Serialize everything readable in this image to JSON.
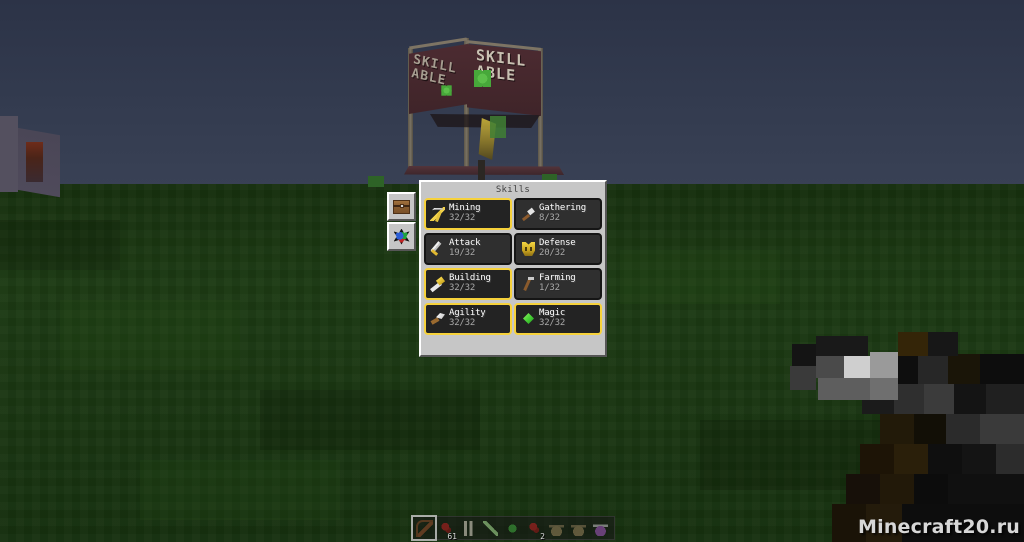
{
  "game": {
    "title": "Minecraft",
    "watermark": "Minecraft20.ru"
  },
  "world": {
    "sign": {
      "line1": "SKILL",
      "line2": "ABLE",
      "left_line1": "SKILL",
      "left_line2": "ABLE"
    }
  },
  "tabs": [
    {
      "id": "tab-inventory",
      "icon": "chest-icon",
      "selected": true
    },
    {
      "id": "tab-skills",
      "icon": "web-icon",
      "selected": false
    }
  ],
  "panel": {
    "title": "Skills",
    "skills": [
      {
        "name": "Mining",
        "level": "32/32",
        "current": 32,
        "max": 32,
        "icon": "pickaxe-icon",
        "maxed": true
      },
      {
        "name": "Gathering",
        "level": "8/32",
        "current": 8,
        "max": 32,
        "icon": "stick-icon",
        "maxed": false
      },
      {
        "name": "Attack",
        "level": "19/32",
        "current": 19,
        "max": 32,
        "icon": "sword-icon",
        "maxed": false
      },
      {
        "name": "Defense",
        "level": "20/32",
        "current": 20,
        "max": 32,
        "icon": "armor-icon",
        "maxed": false
      },
      {
        "name": "Building",
        "level": "32/32",
        "current": 32,
        "max": 32,
        "icon": "hammer-icon",
        "maxed": true
      },
      {
        "name": "Farming",
        "level": "1/32",
        "current": 1,
        "max": 32,
        "icon": "hoe-icon",
        "maxed": false
      },
      {
        "name": "Agility",
        "level": "32/32",
        "current": 32,
        "max": 32,
        "icon": "feather-icon",
        "maxed": true
      },
      {
        "name": "Magic",
        "level": "32/32",
        "current": 32,
        "max": 32,
        "icon": "gem-icon",
        "maxed": true
      }
    ]
  },
  "hotbar": {
    "selected_index": 0,
    "slots": [
      {
        "icon": "bow-icon",
        "count": ""
      },
      {
        "icon": "redstone-icon",
        "count": "61"
      },
      {
        "icon": "bone-icon",
        "count": ""
      },
      {
        "icon": "sword-icon",
        "count": ""
      },
      {
        "icon": "emerald-icon",
        "count": ""
      },
      {
        "icon": "redstone-icon",
        "count": "2"
      },
      {
        "icon": "bottle-icon",
        "count": ""
      },
      {
        "icon": "bottle-icon",
        "count": ""
      },
      {
        "icon": "potion-icon",
        "count": ""
      }
    ]
  },
  "colors": {
    "panel_bg": "#c6c6c6",
    "skill_bg": "#2f2f2f",
    "maxed_border": "#f7d23b",
    "sky": "#333b4f",
    "ground": "#1c3a13"
  }
}
